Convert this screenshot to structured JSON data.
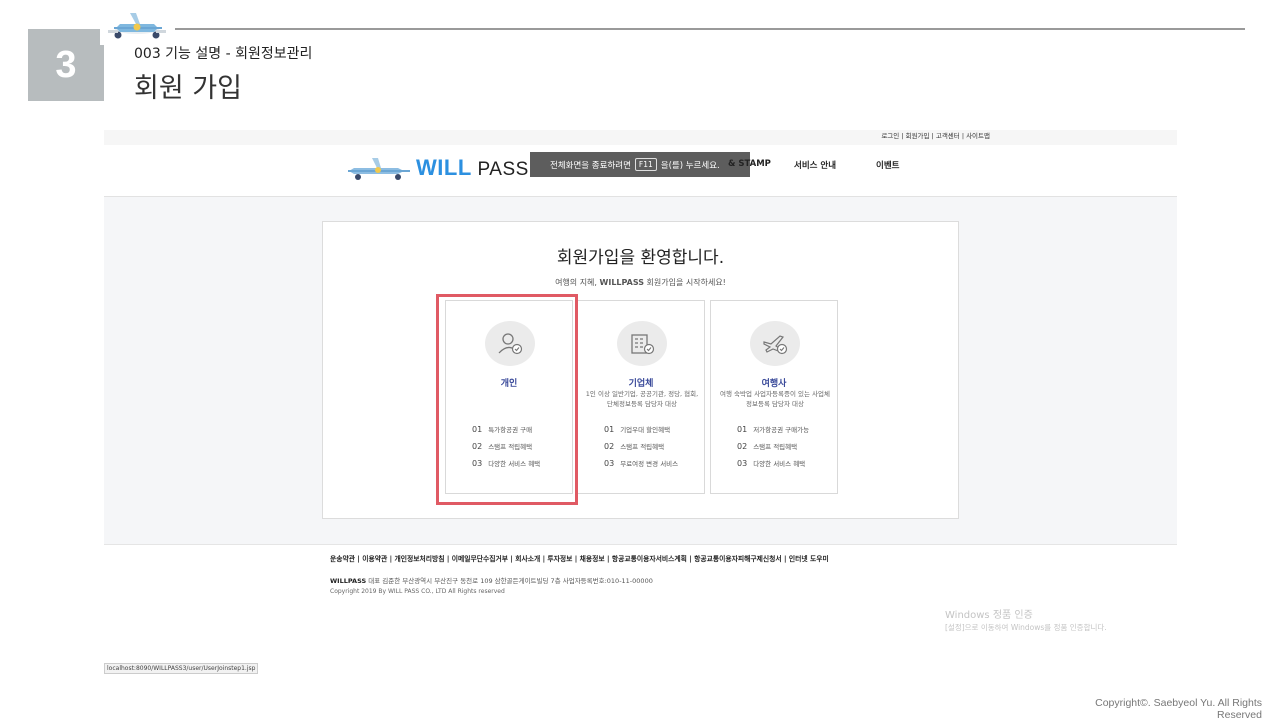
{
  "slide": {
    "number": "3",
    "subtitle": "003 기능 설명 - 회원정보관리",
    "title": "회원 가입",
    "copyright": "Copyright©. Saebyeol Yu. All Rights Reserved"
  },
  "browser": {
    "util_links": "로그인 | 회원가입 | 고객센터 | 사이트맵",
    "logo": {
      "part1": "WILL",
      "part2": "PASS"
    },
    "fullscreen_banner": {
      "text_before": "전체화면을 종료하려면",
      "key": "F11",
      "text_after": "을(를) 누르세요."
    },
    "nav": {
      "stamp": "& STAMP",
      "service": "서비스 안내",
      "event": "이벤트"
    },
    "join": {
      "title": "회원가입을 환영합니다.",
      "subtitle_pre": "여행의 지혜, ",
      "subtitle_brand": "WILLPASS",
      "subtitle_post": " 회원가입을 시작하세요!",
      "cards": [
        {
          "name": "개인",
          "desc": "",
          "icon": "person-check-icon",
          "benefits": [
            {
              "num": "01",
              "text": "특가항공권 구매"
            },
            {
              "num": "02",
              "text": "스탬프 적립혜택"
            },
            {
              "num": "03",
              "text": "다양한 서비스 혜택"
            }
          ]
        },
        {
          "name": "기업체",
          "desc": "1인 이상 일반기업, 공공기관, 정당, 협회, 단체정보등록 담당자 대상",
          "icon": "building-check-icon",
          "benefits": [
            {
              "num": "01",
              "text": "기업우대 할인혜택"
            },
            {
              "num": "02",
              "text": "스탬프 적립혜택"
            },
            {
              "num": "03",
              "text": "무료여정 변경 서비스"
            }
          ]
        },
        {
          "name": "여행사",
          "desc": "여행 숙박업 사업자등록증이 있는 사업체 정보등록 담당자 대상",
          "icon": "plane-check-icon",
          "benefits": [
            {
              "num": "01",
              "text": "저가항공권 구매가능"
            },
            {
              "num": "02",
              "text": "스탬프 적립혜택"
            },
            {
              "num": "03",
              "text": "다양한 서비스 혜택"
            }
          ]
        }
      ]
    },
    "footer": {
      "links": "운송약관 | 이용약관 | 개인정보처리방침 | 이메일무단수집거부 | 회사소개 | 투자정보 | 채용정보 | 항공교통이용자서비스계획 | 항공교통이용자피해구제신청서 | 인터넷 도우미",
      "company_brand": "WILLPASS",
      "company_info": " 대표 김준한 부산광역시 부산진구 동천로 109 삼한골든게이트빌딩 7층 사업자등록번호:010-11-00000",
      "copyright": "Copyright 2019 By WILL PASS CO., LTD All Rights reserved"
    },
    "windows_activation": {
      "title": "Windows 정품 인증",
      "message": "[설정]으로 이동하여 Windows를 정품 인증합니다."
    },
    "status_url": "localhost:8090/WILLPASS3/user/UserJoinstep1.jsp"
  },
  "colors": {
    "accent_blue": "#2c90e0",
    "highlight_red": "#e05a64",
    "card_title": "#3a4a9a",
    "slide_number_bg": "#b7bcbe"
  }
}
